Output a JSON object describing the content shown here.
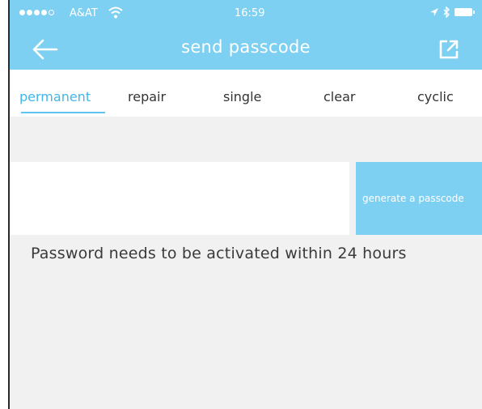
{
  "status_bar": {
    "carrier": "A&AT",
    "time": "16:59"
  },
  "nav": {
    "title": "send passcode",
    "back_icon": "arrow-left-icon",
    "share_icon": "share-export-icon"
  },
  "tabs": [
    {
      "label": "permanent",
      "active": true
    },
    {
      "label": "repair",
      "active": false
    },
    {
      "label": "single",
      "active": false
    },
    {
      "label": "clear",
      "active": false
    },
    {
      "label": "cyclic",
      "active": false
    }
  ],
  "form": {
    "passcode_value": "",
    "generate_label": "generate a passcode"
  },
  "notice": "Password needs to be activated within 24 hours",
  "colors": {
    "accent": "#7dd0f1",
    "active_tab": "#3fb7ea",
    "background": "#f1f1f1"
  }
}
